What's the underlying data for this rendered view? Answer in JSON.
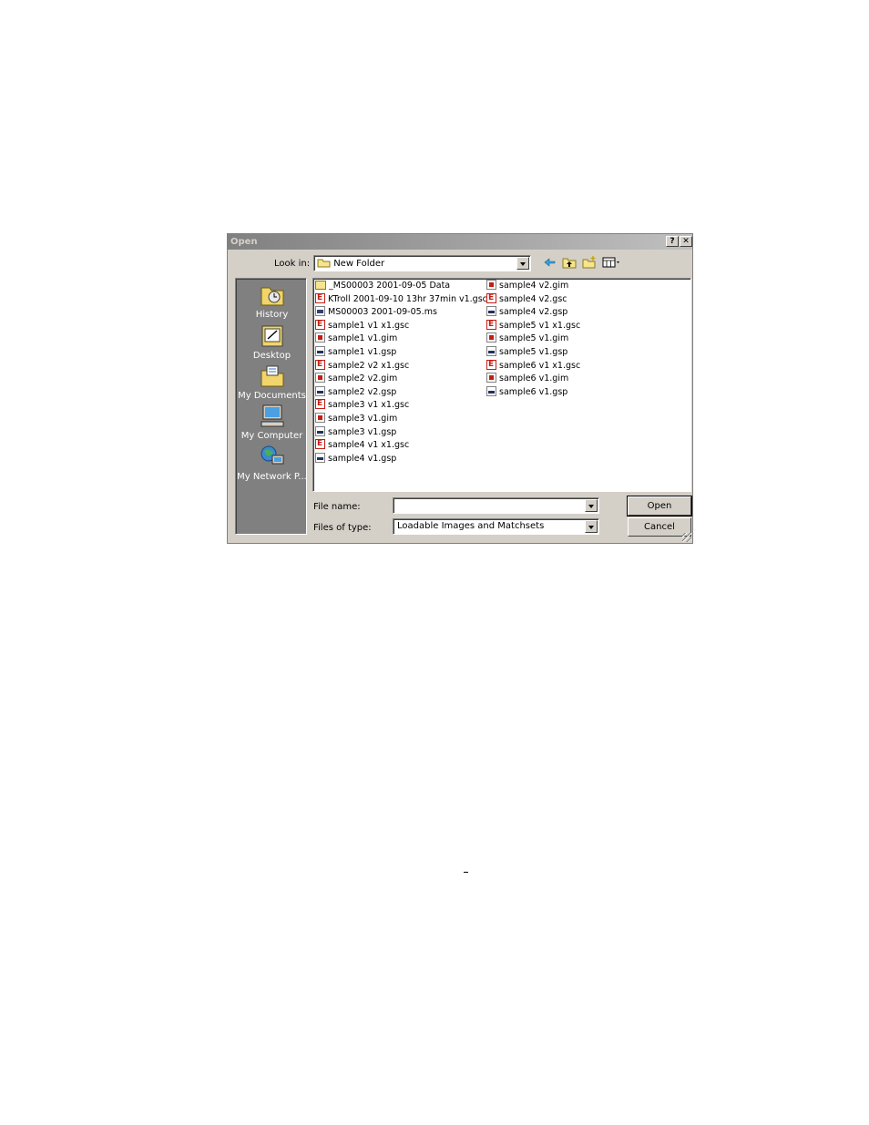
{
  "dialog": {
    "title": "Open",
    "help_label": "?",
    "close_label": "✕",
    "look_in_label": "Look in:",
    "look_in_value": "New Folder",
    "toolbar_icons": [
      "back-arrow-icon",
      "up-folder-icon",
      "new-folder-icon",
      "view-menu-icon"
    ],
    "places": [
      {
        "label": "History",
        "icon": "history-icon"
      },
      {
        "label": "Desktop",
        "icon": "desktop-icon"
      },
      {
        "label": "My Documents",
        "icon": "my-documents-icon"
      },
      {
        "label": "My Computer",
        "icon": "my-computer-icon"
      },
      {
        "label": "My Network P...",
        "icon": "my-network-places-icon"
      }
    ],
    "files_col1": [
      {
        "name": "_MS00003 2001-09-05 Data",
        "type": "folder"
      },
      {
        "name": "KTroll 2001-09-10 13hr 37min v1.gsc",
        "type": "gsc"
      },
      {
        "name": "MS00003 2001-09-05.ms",
        "type": "ms"
      },
      {
        "name": "sample1 v1 x1.gsc",
        "type": "gsc"
      },
      {
        "name": "sample1 v1.gim",
        "type": "gim"
      },
      {
        "name": "sample1 v1.gsp",
        "type": "gsp"
      },
      {
        "name": "sample2 v2 x1.gsc",
        "type": "gsc"
      },
      {
        "name": "sample2 v2.gim",
        "type": "gim"
      },
      {
        "name": "sample2 v2.gsp",
        "type": "gsp"
      },
      {
        "name": "sample3 v1 x1.gsc",
        "type": "gsc"
      },
      {
        "name": "sample3 v1.gim",
        "type": "gim"
      },
      {
        "name": "sample3 v1.gsp",
        "type": "gsp"
      },
      {
        "name": "sample4 v1 x1.gsc",
        "type": "gsc"
      },
      {
        "name": "sample4 v1.gsp",
        "type": "gsp"
      }
    ],
    "files_col2": [
      {
        "name": "sample4 v2.gim",
        "type": "gim"
      },
      {
        "name": "sample4 v2.gsc",
        "type": "gsc"
      },
      {
        "name": "sample4 v2.gsp",
        "type": "gsp"
      },
      {
        "name": "sample5 v1 x1.gsc",
        "type": "gsc"
      },
      {
        "name": "sample5 v1.gim",
        "type": "gim"
      },
      {
        "name": "sample5 v1.gsp",
        "type": "gsp"
      },
      {
        "name": "sample6 v1 x1.gsc",
        "type": "gsc"
      },
      {
        "name": "sample6 v1.gim",
        "type": "gim"
      },
      {
        "name": "sample6 v1.gsp",
        "type": "gsp"
      }
    ],
    "file_name_label": "File name:",
    "file_name_value": "",
    "files_of_type_label": "Files of type:",
    "files_of_type_value": "Loadable Images and Matchsets",
    "open_label": "Open",
    "cancel_label": "Cancel"
  }
}
